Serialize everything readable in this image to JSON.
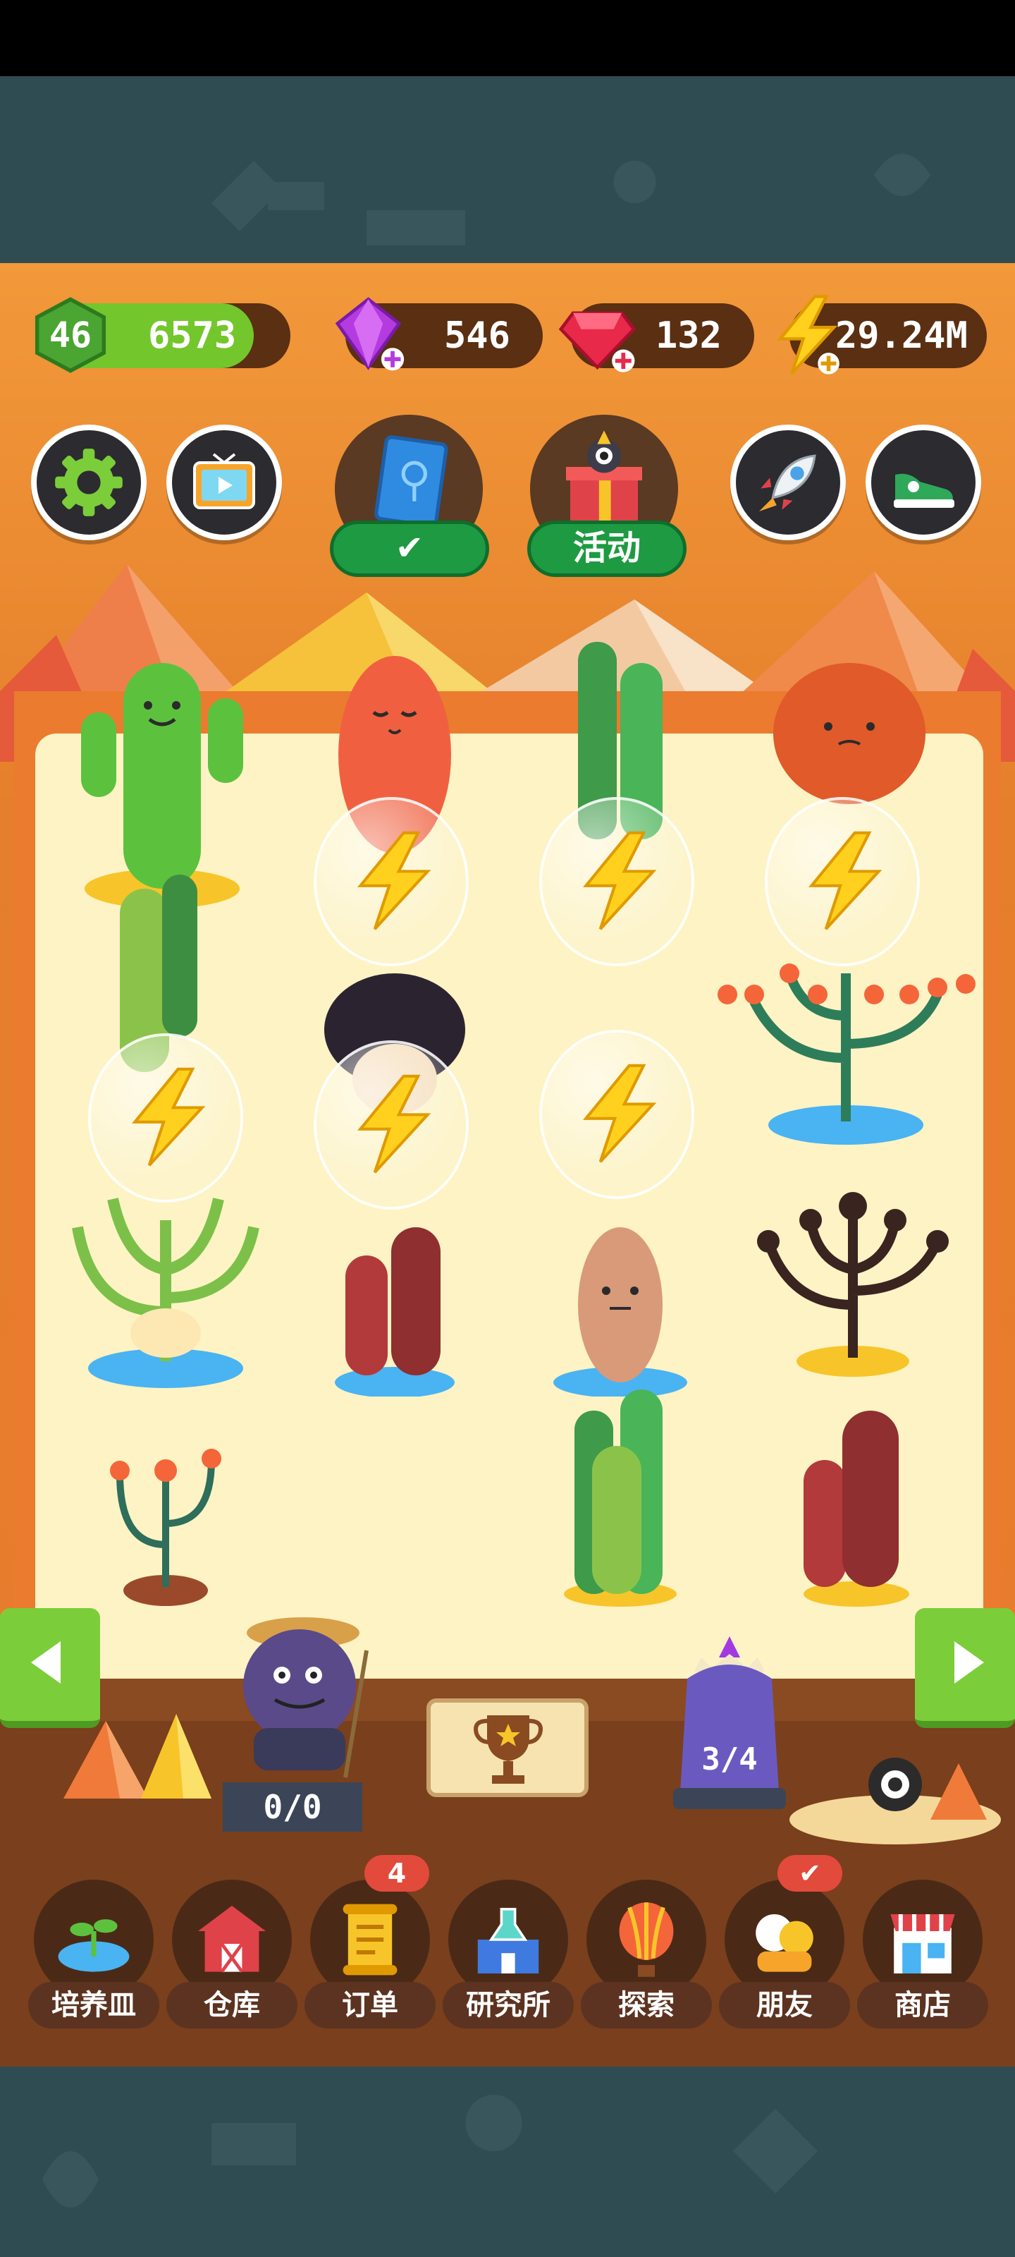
{
  "resources": {
    "level": "46",
    "coins": "6573",
    "purple_gems": "546",
    "red_gems": "132",
    "energy": "29.24M"
  },
  "top_buttons": {
    "book_status": "✔",
    "event_label": "活动"
  },
  "counters": {
    "farmer": "0/0",
    "crystal": "3/4"
  },
  "nav": {
    "items": [
      {
        "label": "培养皿",
        "icon": "sprout-dish-icon"
      },
      {
        "label": "仓库",
        "icon": "barn-icon"
      },
      {
        "label": "订单",
        "icon": "scroll-icon"
      },
      {
        "label": "研究所",
        "icon": "lab-icon"
      },
      {
        "label": "探索",
        "icon": "balloon-icon"
      },
      {
        "label": "朋友",
        "icon": "friends-icon"
      },
      {
        "label": "商店",
        "icon": "shop-icon"
      }
    ],
    "orders_badge": "4",
    "friends_badge": "✔"
  },
  "colors": {
    "accent_green": "#7ccd3a",
    "resource_bg": "#5a2f12",
    "board_bg": "#fdf3c4",
    "frame_orange": "#ea7b2f"
  }
}
